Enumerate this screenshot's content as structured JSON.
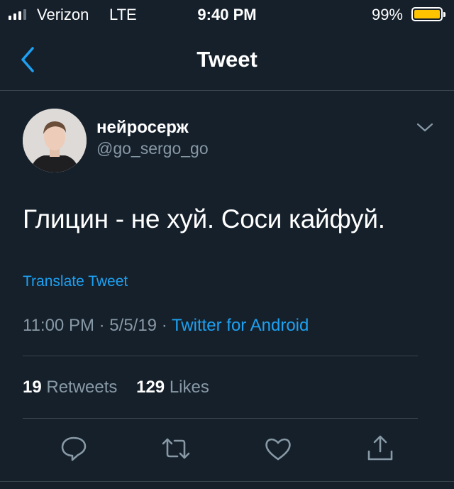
{
  "status_bar": {
    "carrier": "Verizon",
    "network": "LTE",
    "time": "9:40 PM",
    "battery_percent": "99%",
    "battery_level": 0.99,
    "battery_color": "#ffc400"
  },
  "nav": {
    "title": "Tweet",
    "back_icon": "chevron-left-icon"
  },
  "tweet": {
    "author_name": "нейросерж",
    "author_handle": "@go_sergo_go",
    "text": "Глицин - не хуй. Соси кайфуй.",
    "translate_label": "Translate Tweet",
    "time": "11:00 PM",
    "date": "5/5/19",
    "separator": "·",
    "source": "Twitter for Android",
    "retweets_count": "19",
    "retweets_label": "Retweets",
    "likes_count": "129",
    "likes_label": "Likes"
  },
  "actions": [
    "reply-icon",
    "retweet-icon",
    "like-icon",
    "share-icon"
  ],
  "colors": {
    "background": "#15202b",
    "accent": "#1da1f2",
    "secondary_text": "#8899a6",
    "divider": "#38444d"
  }
}
